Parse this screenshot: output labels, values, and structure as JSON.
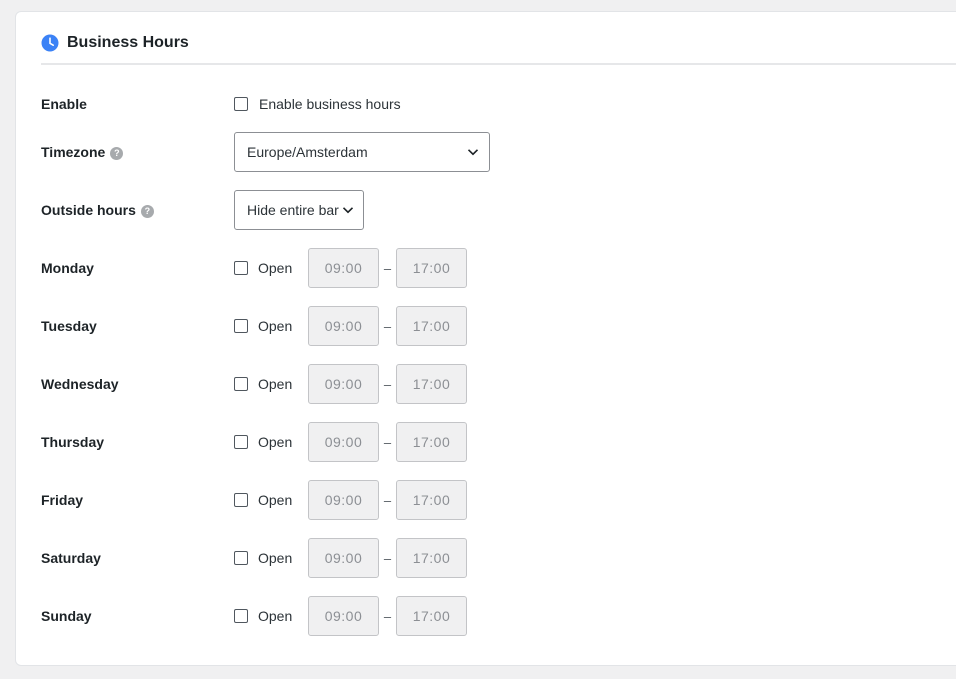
{
  "section": {
    "title": "Business Hours",
    "icon": "clock-icon"
  },
  "enable": {
    "label": "Enable",
    "checkbox_label": "Enable business hours",
    "checked": false
  },
  "timezone": {
    "label": "Timezone",
    "value": "Europe/Amsterdam"
  },
  "outside_hours": {
    "label": "Outside hours",
    "value": "Hide entire bar"
  },
  "days": [
    {
      "label": "Monday",
      "open_label": "Open",
      "start": "09:00",
      "end": "17:00"
    },
    {
      "label": "Tuesday",
      "open_label": "Open",
      "start": "09:00",
      "end": "17:00"
    },
    {
      "label": "Wednesday",
      "open_label": "Open",
      "start": "09:00",
      "end": "17:00"
    },
    {
      "label": "Thursday",
      "open_label": "Open",
      "start": "09:00",
      "end": "17:00"
    },
    {
      "label": "Friday",
      "open_label": "Open",
      "start": "09:00",
      "end": "17:00"
    },
    {
      "label": "Saturday",
      "open_label": "Open",
      "start": "09:00",
      "end": "17:00"
    },
    {
      "label": "Sunday",
      "open_label": "Open",
      "start": "09:00",
      "end": "17:00"
    }
  ],
  "separator": "–",
  "colors": {
    "accent": "#3b82f6",
    "disabled_bg": "#f0f0f1"
  }
}
